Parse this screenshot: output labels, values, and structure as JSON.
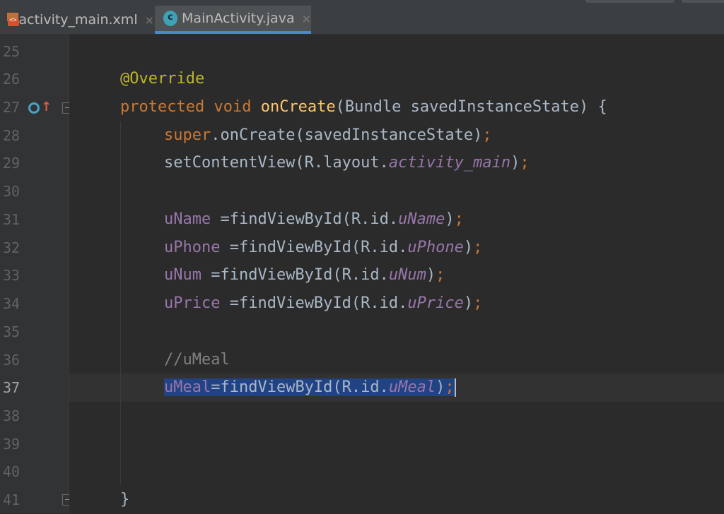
{
  "tabs": [
    {
      "label": "activity_main.xml",
      "icon": "xml-file-icon",
      "active": false,
      "close": "×"
    },
    {
      "label": "MainActivity.java",
      "icon": "java-class-icon",
      "active": true,
      "close": "×",
      "icon_letter": "c"
    }
  ],
  "gutter": {
    "line_numbers": [
      "25",
      "26",
      "27",
      "28",
      "29",
      "30",
      "31",
      "32",
      "33",
      "34",
      "35",
      "36",
      "37",
      "38",
      "39",
      "40",
      "41"
    ],
    "current_line": "37"
  },
  "code": {
    "l26": {
      "annotation": "@Override"
    },
    "l27": {
      "kw1": "protected",
      "kw2": "void",
      "method": "onCreate",
      "rest": "(Bundle savedInstanceState) {"
    },
    "l28": {
      "kw": "super",
      "rest": ".onCreate(savedInstanceState)",
      "semi": ";"
    },
    "l29": {
      "pre": "setContentView(R.layout.",
      "ref": "activity_main",
      "post": ")",
      "semi": ";"
    },
    "l31": {
      "field": "uName",
      "pre": " =findViewById(R.id.",
      "ref": "uName",
      "post": ")",
      "semi": ";"
    },
    "l32": {
      "field": "uPhone",
      "pre": " =findViewById(R.id.",
      "ref": "uPhone",
      "post": ")",
      "semi": ";"
    },
    "l33": {
      "field": "uNum",
      "pre": " =findViewById(R.id.",
      "ref": "uNum",
      "post": ")",
      "semi": ";"
    },
    "l34": {
      "field": "uPrice",
      "pre": " =findViewById(R.id.",
      "ref": "uPrice",
      "post": ")",
      "semi": ";"
    },
    "l36": {
      "comment": "//uMeal"
    },
    "l37": {
      "field": "uMeal",
      "pre": "=findViewById(R.id.",
      "ref": "uMeal",
      "post": ")",
      "semi": ";"
    },
    "l41": {
      "brace": "}"
    }
  },
  "colors": {
    "background": "#2b2b2b",
    "keyword": "#cc7832",
    "annotation": "#bbb529",
    "method": "#ffc66d",
    "field": "#9876aa",
    "comment": "#808080",
    "selection": "#214283"
  }
}
